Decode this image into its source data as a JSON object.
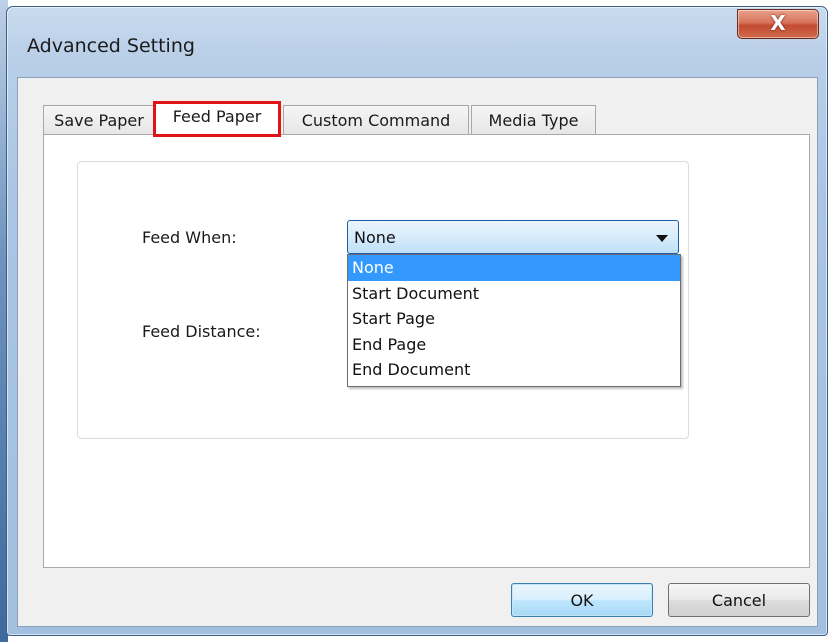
{
  "window": {
    "title": "Advanced Setting",
    "close_glyph": "X"
  },
  "tabs": [
    {
      "label": "Save Paper",
      "active": false
    },
    {
      "label": "Feed Paper",
      "active": true
    },
    {
      "label": "Custom Command",
      "active": false
    },
    {
      "label": "Media Type",
      "active": false
    }
  ],
  "form": {
    "feed_when_label": "Feed When:",
    "feed_distance_label": "Feed Distance:",
    "feed_when_value": "None",
    "feed_when_options": [
      "None",
      "Start Document",
      "Start Page",
      "End Page",
      "End Document"
    ]
  },
  "buttons": {
    "ok_label": "OK",
    "cancel_label": "Cancel"
  },
  "colors": {
    "highlight": "#3399ff",
    "active_tab_outline": "#e01414"
  }
}
